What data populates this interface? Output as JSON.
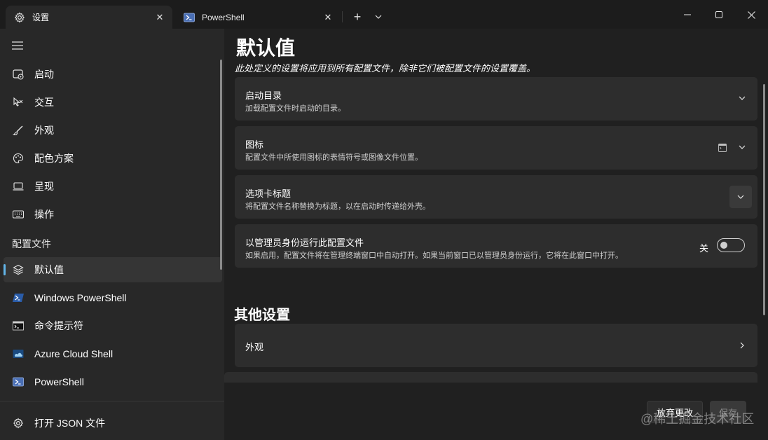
{
  "titlebar": {
    "tabs": [
      {
        "label": "设置",
        "icon": "gear-icon"
      },
      {
        "label": "PowerShell",
        "icon": "powershell-icon"
      }
    ],
    "close_glyph": "✕",
    "new_tab_glyph": "+"
  },
  "sidebar": {
    "items": [
      {
        "label": "启动",
        "icon": "startup-icon"
      },
      {
        "label": "交互",
        "icon": "interaction-icon"
      },
      {
        "label": "外观",
        "icon": "brush-icon"
      },
      {
        "label": "配色方案",
        "icon": "palette-icon"
      },
      {
        "label": "呈现",
        "icon": "monitor-icon"
      },
      {
        "label": "操作",
        "icon": "keyboard-icon"
      }
    ],
    "section_label": "配置文件",
    "profiles": [
      {
        "label": "默认值",
        "icon": "layers-icon"
      },
      {
        "label": "Windows PowerShell",
        "icon": "powershell-icon"
      },
      {
        "label": "命令提示符",
        "icon": "cmd-icon"
      },
      {
        "label": "Azure Cloud Shell",
        "icon": "azure-icon"
      },
      {
        "label": "PowerShell",
        "icon": "powershell-icon"
      }
    ],
    "open_json": {
      "label": "打开 JSON 文件",
      "icon": "gear-icon"
    }
  },
  "main": {
    "title": "默认值",
    "subtitle": "此处定义的设置将应用到所有配置文件，除非它们被配置文件的设置覆盖。",
    "cards": [
      {
        "title": "启动目录",
        "desc": "加载配置文件时启动的目录。"
      },
      {
        "title": "图标",
        "desc": "配置文件中所使用图标的表情符号或图像文件位置。"
      },
      {
        "title": "选项卡标题",
        "desc": "将配置文件名称替换为标题，以在启动时传递给外壳。"
      },
      {
        "title": "以管理员身份运行此配置文件",
        "desc": "如果启用，配置文件将在管理终端窗口中自动打开。如果当前窗口已以管理员身份运行，它将在此窗口中打开。",
        "toggle_label": "关",
        "toggle_on": false
      }
    ],
    "other_section": "其他设置",
    "other_cards": [
      {
        "title": "外观"
      }
    ]
  },
  "footer": {
    "discard_label": "放弃更改",
    "save_label": "保存",
    "watermark": "@稀土掘金技术社区"
  },
  "colors": {
    "accent": "#62b5e8",
    "background": "#202020",
    "card": "#2d2d2d",
    "sidebar": "#282828"
  }
}
